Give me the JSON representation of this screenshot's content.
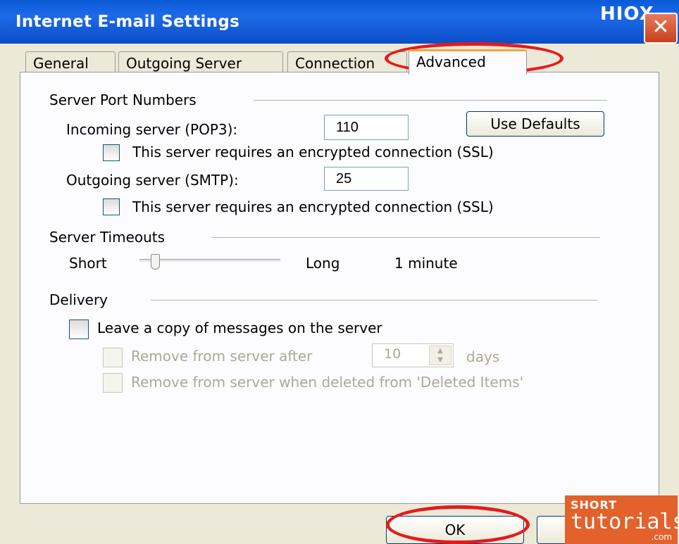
{
  "window": {
    "title": "Internet E-mail Settings",
    "corner_logo": "HIOX",
    "close_label": "✕"
  },
  "tabs": [
    {
      "label": "General",
      "active": false
    },
    {
      "label": "Outgoing Server",
      "active": false
    },
    {
      "label": "Connection",
      "active": false
    },
    {
      "label": "Advanced",
      "active": true
    }
  ],
  "port_numbers": {
    "group_title": "Server Port Numbers",
    "incoming_label": "Incoming server (POP3):",
    "incoming_value": "110",
    "incoming_ssl_label": "This server requires an encrypted connection (SSL)",
    "incoming_ssl_checked": false,
    "outgoing_label": "Outgoing server (SMTP):",
    "outgoing_value": "25",
    "outgoing_ssl_label": "This server requires an encrypted connection (SSL)",
    "outgoing_ssl_checked": false,
    "use_defaults_label": "Use Defaults"
  },
  "timeouts": {
    "group_title": "Server Timeouts",
    "short_label": "Short",
    "long_label": "Long",
    "value_text": "1 minute",
    "slider_level": 0.08
  },
  "delivery": {
    "group_title": "Delivery",
    "leave_copy_label": "Leave a copy of messages on the server",
    "leave_copy_checked": false,
    "remove_after_label": "Remove from server after",
    "remove_after_value": "10",
    "days_label": "days",
    "remove_deleted_label": "Remove from server when deleted from 'Deleted Items'"
  },
  "buttons": {
    "ok_label": "OK"
  },
  "watermark": {
    "line1": "SHORT",
    "line2": "tutorials",
    "line3": ".com"
  },
  "colors": {
    "titlebar": "#0b55d4",
    "dialog_bg": "#ece9d8",
    "highlight_oval": "#e41b1b",
    "watermark_bg": "#e3622b"
  }
}
